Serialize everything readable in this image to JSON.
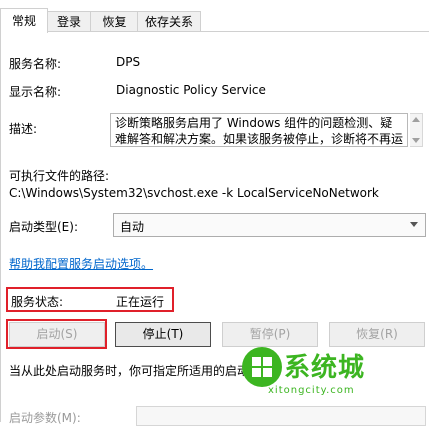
{
  "tabs": [
    {
      "label": "常规",
      "active": true
    },
    {
      "label": "登录",
      "active": false
    },
    {
      "label": "恢复",
      "active": false
    },
    {
      "label": "依存关系",
      "active": false
    }
  ],
  "fields": {
    "service_name_label": "服务名称:",
    "service_name_value": "DPS",
    "display_name_label": "显示名称:",
    "display_name_value": "Diagnostic Policy Service",
    "description_label": "描述:",
    "description_line1": "诊断策略服务启用了 Windows 组件的问题检测、疑",
    "description_line2": "难解答和解决方案。如果该服务被停止，诊断将不再运",
    "exe_path_label": "可执行文件的路径:",
    "exe_path_value": "C:\\Windows\\System32\\svchost.exe -k LocalServiceNoNetwork",
    "startup_type_label": "启动类型(E):",
    "startup_type_value": "自动",
    "help_link": "帮助我配置服务启动选项。",
    "service_status_label": "服务状态:",
    "service_status_value": "正在运行"
  },
  "buttons": {
    "start": "启动(S)",
    "stop": "停止(T)",
    "pause": "暂停(P)",
    "resume": "恢复(R)"
  },
  "hint_text": "当从此处启动服务时，你可指定所适用的启动",
  "start_params_label": "启动参数(M):",
  "watermark": {
    "brand": "系统城",
    "domain": "xitongcity.com"
  },
  "colors": {
    "highlight_border": "#e0202a",
    "link": "#0066cc",
    "watermark_green": "#3cb521"
  }
}
